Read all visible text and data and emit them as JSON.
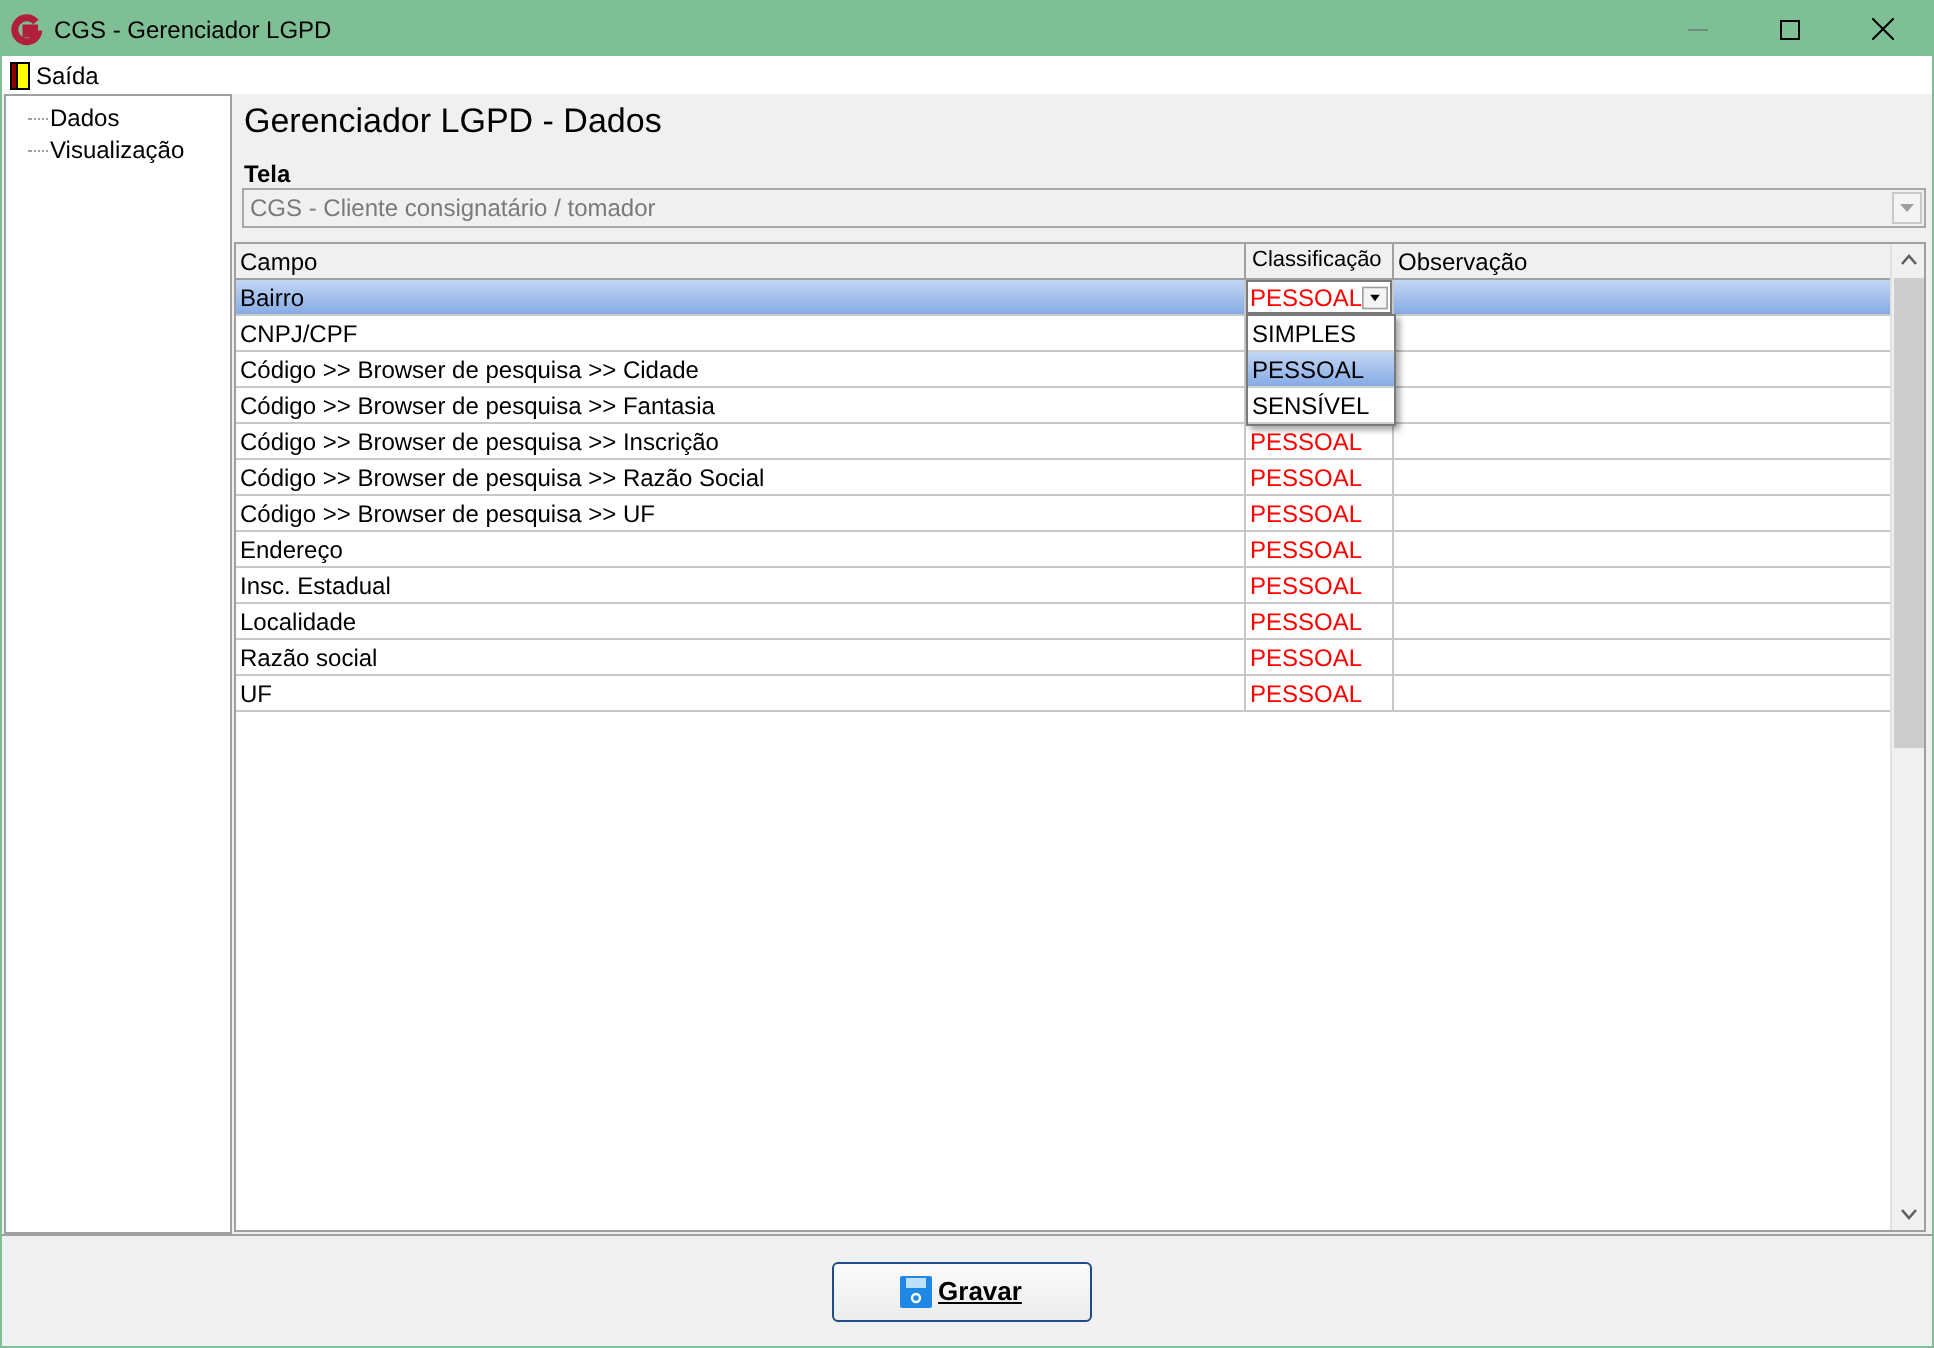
{
  "window": {
    "title": "CGS - Gerenciador LGPD"
  },
  "menu": [
    {
      "label": "Saída"
    }
  ],
  "tree": {
    "items": [
      {
        "label": "Dados"
      },
      {
        "label": "Visualização"
      }
    ]
  },
  "heading": "Gerenciador LGPD - Dados",
  "tela": {
    "label": "Tela",
    "value": "CGS - Cliente consignatário / tomador",
    "disabled": true
  },
  "table": {
    "columns": [
      "Campo",
      "Classificação",
      "Observação"
    ],
    "rows": [
      {
        "campo": "Bairro",
        "classificacao": "PESSOAL",
        "selected": true,
        "dropdown": {
          "options": [
            {
              "label": "SIMPLES",
              "selected": false
            },
            {
              "label": "PESSOAL",
              "selected": true
            },
            {
              "label": "SENSÍVEL",
              "selected": false
            }
          ]
        }
      },
      {
        "campo": "CNPJ/CPF",
        "selected": false
      },
      {
        "campo": "Código >> Browser de pesquisa >> Cidade",
        "selected": false
      },
      {
        "campo": "Código >> Browser de pesquisa >> Fantasia",
        "selected": false
      },
      {
        "campo": "Código >> Browser de pesquisa >> Inscrição",
        "classificacao": "PESSOAL",
        "selected": false
      },
      {
        "campo": "Código >> Browser de pesquisa >> Razão Social",
        "classificacao": "PESSOAL",
        "selected": false
      },
      {
        "campo": "Código >> Browser de pesquisa >> UF",
        "classificacao": "PESSOAL",
        "selected": false
      },
      {
        "campo": "Endereço",
        "classificacao": "PESSOAL",
        "selected": false
      },
      {
        "campo": "Insc. Estadual",
        "classificacao": "PESSOAL",
        "selected": false
      },
      {
        "campo": "Localidade",
        "classificacao": "PESSOAL",
        "selected": false
      },
      {
        "campo": "Razão social",
        "classificacao": "PESSOAL",
        "selected": false
      },
      {
        "campo": "UF",
        "classificacao": "PESSOAL",
        "selected": false
      }
    ]
  },
  "save_button": {
    "label": "Gravar"
  }
}
